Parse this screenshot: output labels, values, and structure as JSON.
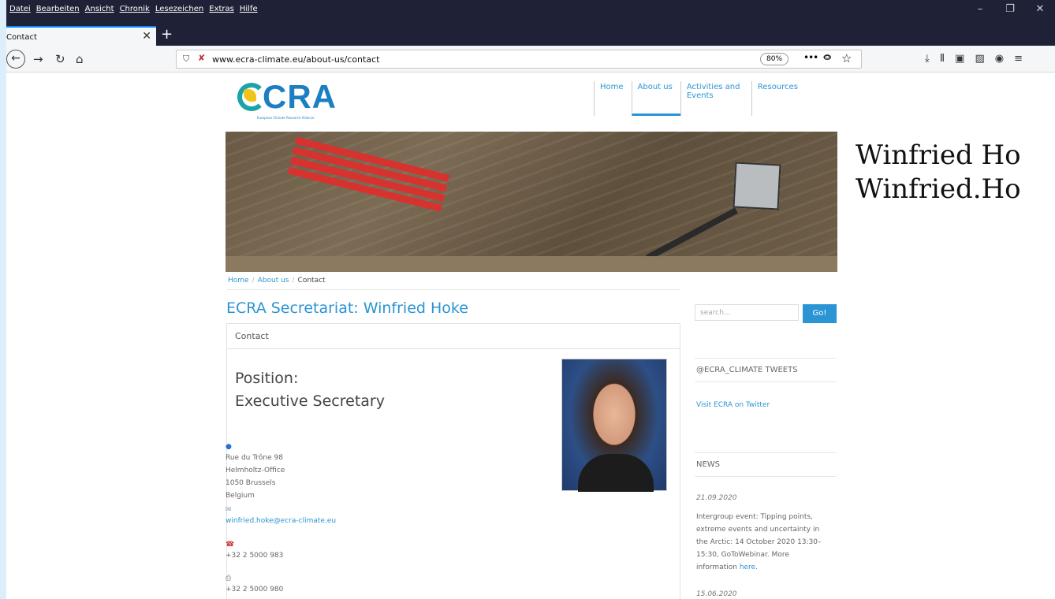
{
  "menubar": {
    "items": [
      "Datei",
      "Bearbeiten",
      "Ansicht",
      "Chronik",
      "Lesezeichen",
      "Extras",
      "Hilfe"
    ]
  },
  "window_controls": {
    "minimize": "–",
    "restore": "❐",
    "close": "✕"
  },
  "tab": {
    "title": "Contact",
    "close": "✕",
    "new_tab": "+"
  },
  "navbar": {
    "back": "←",
    "forward": "→",
    "reload": "↻",
    "home": "⌂",
    "url": "www.ecra-climate.eu/about-us/contact",
    "zoom": "80%",
    "more": "•••"
  },
  "site": {
    "logo_text": "CRA",
    "logo_subtitle": "European Climate Research Alliance",
    "nav": [
      "Home",
      "About us",
      "Activities and Events",
      "Resources"
    ],
    "breadcrumb": [
      "Home",
      "About us",
      "Contact"
    ],
    "page_title": "ECRA Secretariat: Winfried Hoke",
    "contact_header": "Contact",
    "position_label": "Position:",
    "position_value": "Executive Secretary",
    "address": [
      "Rue du Trône 98",
      "Helmholtz-Office",
      "1050 Brussels",
      "Belgium"
    ],
    "email": "winfried.hoke@ecra-climate.eu",
    "phone": "+32 2 5000 983",
    "fax": "+32 2 5000 980"
  },
  "sidebar": {
    "search_placeholder": "search...",
    "search_button": "Go!",
    "tweets_heading": "@ECRA_CLIMATE TWEETS",
    "twitter_link": "Visit ECRA on Twitter",
    "news_heading": "NEWS",
    "news": [
      {
        "date": "21.09.2020",
        "text": "Intergroup event: Tipping points, extreme events and uncertainty in the Arctic: 14 October 2020 13:30–15:30, GoToWebinar. More information ",
        "link": "here",
        "after": "."
      },
      {
        "date": "15.06.2020"
      }
    ]
  },
  "overlay": {
    "line1": "Winfried Ho",
    "line2": "Winfried.Ho"
  }
}
